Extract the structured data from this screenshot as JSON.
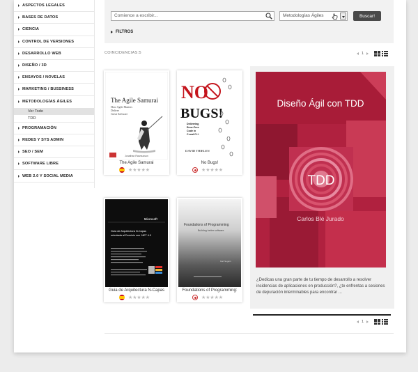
{
  "sidebar": {
    "categories": [
      {
        "label": "ASPECTOS LEGALES"
      },
      {
        "label": "BASES DE DATOS"
      },
      {
        "label": "CIENCIA"
      },
      {
        "label": "CONTROL DE VERSIONES"
      },
      {
        "label": "DESARROLLO WEB"
      },
      {
        "label": "DISEÑO / 3D"
      },
      {
        "label": "ENSAYOS / NOVELAS"
      },
      {
        "label": "MARKETING / BUSSINESS"
      },
      {
        "label": "METODOLOGÍAS ÁGILES"
      },
      {
        "label": "PROGRAMACIÓN"
      },
      {
        "label": "REDES Y SYS ADMIN"
      },
      {
        "label": "SEO / SEM"
      },
      {
        "label": "SOFTWARE LIBRE"
      },
      {
        "label": "WEB 2.0 Y SOCIAL MEDIA"
      }
    ],
    "subitems": [
      {
        "label": "Ver Todo",
        "active": true
      },
      {
        "label": "TDD",
        "active": false
      }
    ]
  },
  "search": {
    "placeholder": "Comience a escribir...",
    "category_value": "Metodologías Ágiles",
    "button_label": "Buscar!",
    "filters_label": "FILTROS"
  },
  "results": {
    "label": "COINCIDENCIAS:",
    "count": "5",
    "page": "1"
  },
  "books": [
    {
      "title": "The Agile Samurai",
      "lang": "es",
      "cover_title": "The Agile Samurai",
      "cover_sub1": "How Agile Masters",
      "cover_sub2": "Deliver",
      "cover_sub3": "Great Software",
      "cover_author": "Jonathan Rasmusson"
    },
    {
      "title": "No Bugs!",
      "lang": "uk",
      "cover_title_a": "NO",
      "cover_title_b": "BUGS!",
      "cover_sub1": "Delivering",
      "cover_sub2": "Error-Free",
      "cover_sub3": "Code in",
      "cover_sub4": "C and C++",
      "cover_author": "DAVID THIELEN"
    },
    {
      "title": "Guia de Arquitectura N-Capas",
      "lang": "es",
      "cover_brand": "Microsoft",
      "cover_text1": "Guía de Arquitectura N-Capas",
      "cover_text2": "orientada al Dominio con .NET 4.0"
    },
    {
      "title": "Foundations of Programming:",
      "lang": "uk",
      "cover_text1": "Foundations of Programming",
      "cover_text2": "Building better software",
      "cover_author": "Karl Seguin"
    }
  ],
  "featured": {
    "cover_title": "Diseño Ágil con TDD",
    "cover_badge": "TDD",
    "cover_author": "Carlos Blé Jurado",
    "description": "¿Dedicas una gran parte de tu tiempo de desarrollo a resolver incidencias de aplicaciones en producción?, ¿te enfrentas a sesiones de depuración interminables para encontrar ..."
  },
  "colors": {
    "tdd_red": "#b0213f",
    "search_button": "#4a4a4a"
  }
}
